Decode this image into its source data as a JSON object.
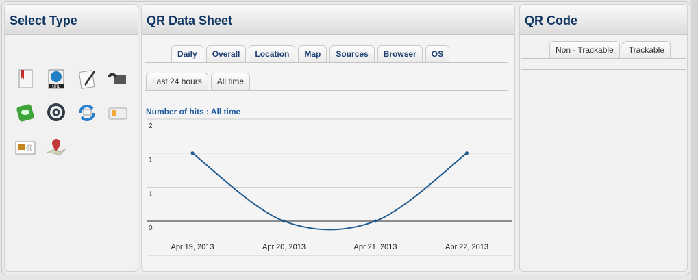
{
  "panels": {
    "select_type": {
      "title": "Select Type",
      "icons": [
        "bookmark-document-icon",
        "url-globe-icon",
        "edit-document-icon",
        "telephone-icon",
        "sms-icon",
        "email-at-icon",
        "sync-email-icon",
        "contact-card-icon",
        "vcard-icon",
        "map-location-icon"
      ]
    },
    "qr_data_sheet": {
      "title": "QR Data Sheet",
      "tabs": [
        "Daily",
        "Overall",
        "Location",
        "Map",
        "Sources",
        "Browser",
        "OS"
      ],
      "subtabs": [
        "Last 24 hours",
        "All time"
      ],
      "chart_title": "Number of hits : All time"
    },
    "qr_code": {
      "title": "QR Code",
      "tabs": [
        "Non - Trackable",
        "Trackable"
      ]
    }
  },
  "chart_data": {
    "type": "line",
    "title": "Number of hits : All time",
    "x": [
      "Apr 19, 2013",
      "Apr 20, 2013",
      "Apr 21, 2013",
      "Apr 22, 2013"
    ],
    "series": [
      {
        "name": "hits",
        "values": [
          1,
          0,
          0,
          1
        ]
      }
    ],
    "yticks": [
      0,
      0.5,
      1,
      1.5
    ],
    "ytick_labels": [
      "0",
      "1",
      "1",
      "2"
    ],
    "ylim": [
      0,
      1.5
    ],
    "grid": true,
    "color": "#1e5a8e"
  }
}
